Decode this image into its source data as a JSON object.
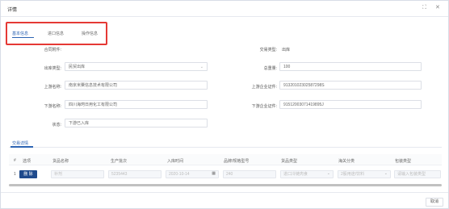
{
  "window": {
    "title": "详情"
  },
  "tabs": [
    {
      "label": "基本信息",
      "active": true
    },
    {
      "label": "进口信息",
      "active": false
    },
    {
      "label": "操作信息",
      "active": false
    }
  ],
  "form": {
    "contract_attachment": {
      "label": "合同附件:"
    },
    "trade_type": {
      "label": "交易类型:",
      "value": "出库"
    },
    "outbound_type": {
      "label": "出库类型:",
      "value": "民贸出库"
    },
    "total_weight": {
      "label": "总重量:",
      "value": "100"
    },
    "upstream_name": {
      "label": "上游名称:",
      "value": "南京米粟信息技术有限公司"
    },
    "upstream_license": {
      "label": "上游企业证件:",
      "value": "91320102302587298S"
    },
    "downstream_name": {
      "label": "下游名称:",
      "value": "四川海珂日用化工有限公司"
    },
    "downstream_license": {
      "label": "下游企业证件:",
      "value": "91512003071419895J"
    },
    "status": {
      "label": "状态:",
      "value": "下游已入库"
    }
  },
  "section": {
    "tab_label": "交易详情"
  },
  "table": {
    "columns": [
      "#",
      "选项",
      "货品名称",
      "生产批次",
      "入库时间",
      "品牌/规格型号",
      "货品类型",
      "海关分类",
      "包装类型"
    ],
    "rows": [
      {
        "index": "1",
        "action_label": "删 除",
        "product_name": "补剂",
        "batch": "5235443",
        "inbound_time": "2020-10-14",
        "brand_spec": "240",
        "product_type": "进口冷链肉食",
        "customs_class": "2股用途/饮料",
        "package_type": "请输入包装类型"
      }
    ]
  },
  "footer": {
    "cancel_label": "取消"
  },
  "colors": {
    "accent": "#2d64b3",
    "highlight": "#e53935",
    "button_dark": "#1f4a8c"
  },
  "icons": [
    "expand-icon",
    "close-icon",
    "chevron-down-icon",
    "calendar-icon"
  ]
}
